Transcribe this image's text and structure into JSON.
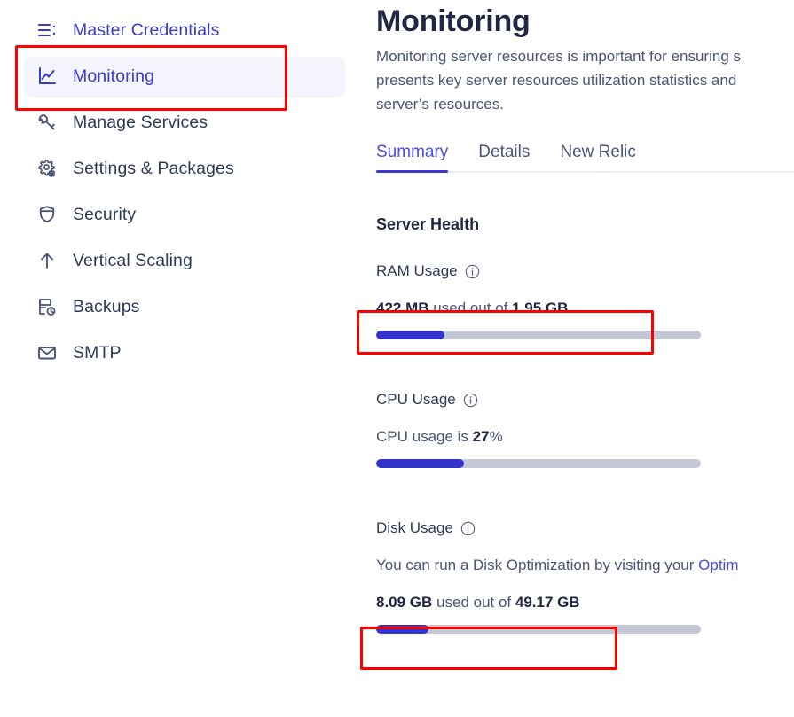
{
  "sidebar": {
    "items": [
      {
        "label": "Master Credentials",
        "icon": "list-menu-icon",
        "style": "accent",
        "active": false
      },
      {
        "label": "Monitoring",
        "icon": "chart-line-icon",
        "style": "accent",
        "active": true
      },
      {
        "label": "Manage Services",
        "icon": "wrench-icon",
        "style": "plain",
        "active": false
      },
      {
        "label": "Settings & Packages",
        "icon": "gear-icon",
        "style": "plain",
        "active": false
      },
      {
        "label": "Security",
        "icon": "shield-icon",
        "style": "plain",
        "active": false
      },
      {
        "label": "Vertical Scaling",
        "icon": "arrow-up-icon",
        "style": "plain",
        "active": false
      },
      {
        "label": "Backups",
        "icon": "backup-restore-icon",
        "style": "plain",
        "active": false
      },
      {
        "label": "SMTP",
        "icon": "envelope-icon",
        "style": "plain",
        "active": false
      }
    ]
  },
  "main": {
    "title": "Monitoring",
    "description": "Monitoring server resources is important for ensuring s\npresents key server resources utilization statistics and\nserver’s resources.",
    "tabs": [
      {
        "label": "Summary",
        "selected": true
      },
      {
        "label": "Details",
        "selected": false
      },
      {
        "label": "New Relic",
        "selected": false
      }
    ],
    "section_title": "Server Health",
    "metrics": [
      {
        "name": "RAM Usage",
        "label": "RAM Usage",
        "info_icon": "info-icon",
        "used": "422 MB",
        "middle": " used out of ",
        "total": "1.95 GB",
        "percent": 21
      },
      {
        "name": "CPU Usage",
        "label": "CPU Usage",
        "info_icon": "info-icon",
        "prefix": "CPU usage is ",
        "value": "27",
        "suffix": "%",
        "percent": 27
      },
      {
        "name": "Disk Usage",
        "label": "Disk Usage",
        "info_icon": "info-icon",
        "note_prefix": "You can run a Disk Optimization by visiting your ",
        "note_link": "Optim",
        "used": "8.09 GB",
        "middle": " used out of ",
        "total": "49.17 GB",
        "percent": 16
      }
    ]
  },
  "colors": {
    "accent": "#3a3ad0",
    "bar_fill": "#3434cc",
    "bar_track": "#c3c8d4",
    "highlight_box": "#fb0000",
    "heading": "#1f2744",
    "body_text": "#4a5578"
  }
}
